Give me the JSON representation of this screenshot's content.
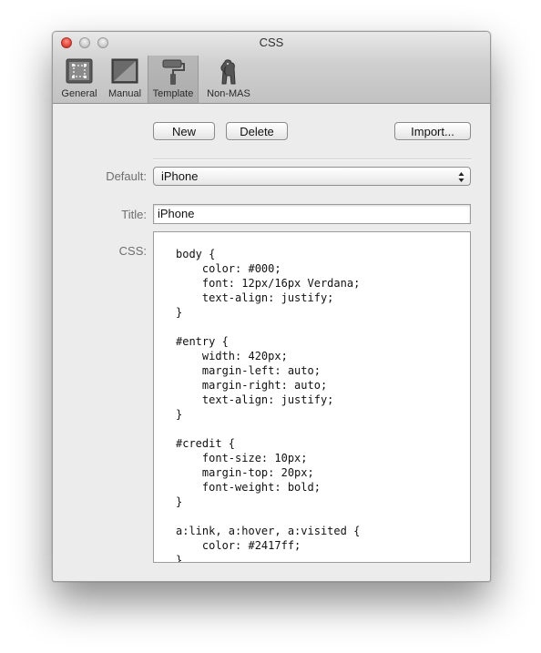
{
  "window": {
    "title": "CSS"
  },
  "toolbar": {
    "items": [
      {
        "label": "General",
        "icon": "general-icon"
      },
      {
        "label": "Manual",
        "icon": "manual-icon"
      },
      {
        "label": "Template",
        "icon": "paint-roller-icon",
        "selected": true
      },
      {
        "label": "Non-MAS",
        "icon": "elephant-icon"
      }
    ]
  },
  "actions": {
    "new_label": "New",
    "delete_label": "Delete",
    "import_label": "Import..."
  },
  "form": {
    "default_label": "Default:",
    "default_value": "iPhone",
    "title_label": "Title:",
    "title_value": "iPhone",
    "css_label": "CSS:"
  },
  "css_code": [
    "body {",
    "    color: #000;",
    "    font: 12px/16px Verdana;",
    "    text-align: justify;",
    "}",
    "",
    "#entry {",
    "    width: 420px;",
    "    margin-left: auto;",
    "    margin-right: auto;",
    "    text-align: justify;",
    "}",
    "",
    "#credit {",
    "    font-size: 10px;",
    "    margin-top: 20px;",
    "    font-weight: bold;",
    "}",
    "",
    "a:link, a:hover, a:visited {",
    "    color: #2417ff;",
    "}"
  ]
}
